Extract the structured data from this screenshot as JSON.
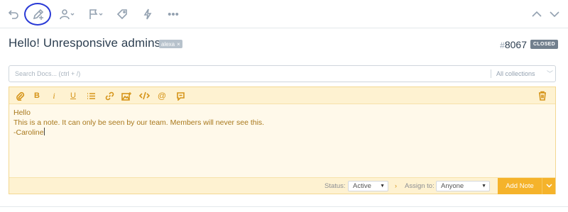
{
  "toolbar": {
    "icons": [
      "undo-icon",
      "add-note-icon",
      "assign-user-icon",
      "flag-icon",
      "tag-icon",
      "workflow-icon",
      "more-icon",
      "previous-icon",
      "next-icon"
    ],
    "more_label": "•••",
    "highlight_color": "#2a3ad6"
  },
  "ticket": {
    "subject": "Hello! Unresponsive admins~",
    "tag": "alexa",
    "tag_remove": "×",
    "number_prefix": "#",
    "number": "8067",
    "status": "CLOSED"
  },
  "search": {
    "placeholder": "Search Docs... (ctrl + /)",
    "collections": "All collections"
  },
  "editor": {
    "tools": [
      "attachment-icon",
      "bold-icon",
      "italic-icon",
      "underline-icon",
      "list-icon",
      "link-icon",
      "image-icon",
      "code-icon",
      "mention-icon",
      "saved-reply-icon",
      "trash-icon"
    ],
    "bold_label": "B",
    "italic_label": "i",
    "underline_label": "U",
    "mention_label": "@",
    "lines": [
      "Hello",
      "This is a note. It can only be seen by our team. Members will never see this.",
      "-Caroline"
    ]
  },
  "footer": {
    "status_label": "Status:",
    "status_value": "Active",
    "assign_label": "Assign to:",
    "assign_value": "Anyone",
    "add_note_label": "Add Note"
  },
  "colors": {
    "accent": "#f5b32b",
    "note_bg": "#fff9ea",
    "note_text": "#a8781c",
    "badge": "#72808e"
  }
}
